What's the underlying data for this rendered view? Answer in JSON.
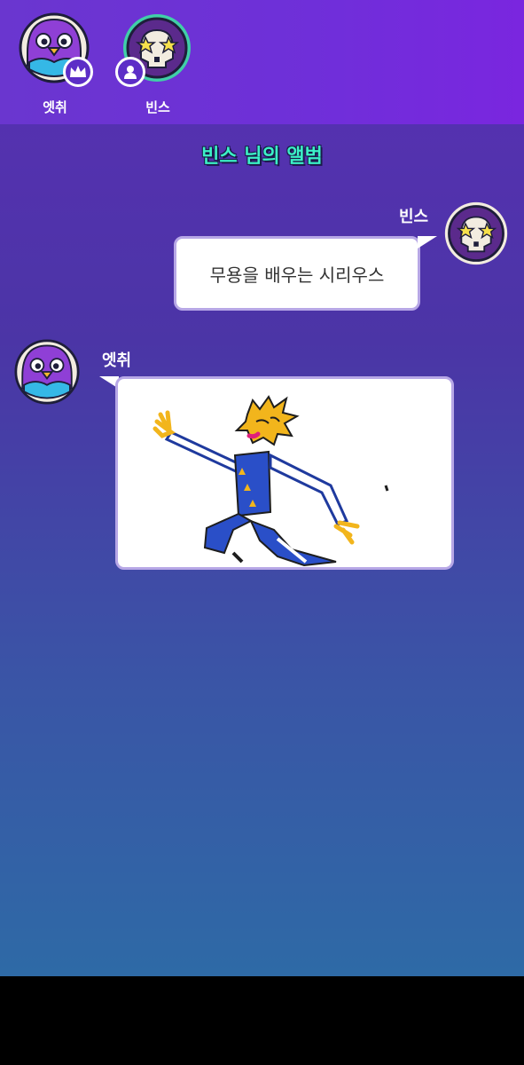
{
  "players": [
    {
      "name": "엣취",
      "avatar": "bird-icon",
      "badge": "crown-icon"
    },
    {
      "name": "빈스",
      "avatar": "skull-star-glasses-icon",
      "badge": "user-icon"
    }
  ],
  "album": {
    "title": "빈스 님의 앨범"
  },
  "messages": [
    {
      "author": "빈스",
      "type": "text",
      "text": "무용을 배우는 시리우스",
      "avatar": "skull-star-glasses-icon"
    },
    {
      "author": "엣취",
      "type": "drawing",
      "drawing": "dancing-figure-drawing",
      "avatar": "bird-icon"
    }
  ],
  "colors": {
    "accent_title": "#3cf0c8",
    "topbar": "#6f2fd9",
    "bubble_border": "#b7a7e6"
  }
}
